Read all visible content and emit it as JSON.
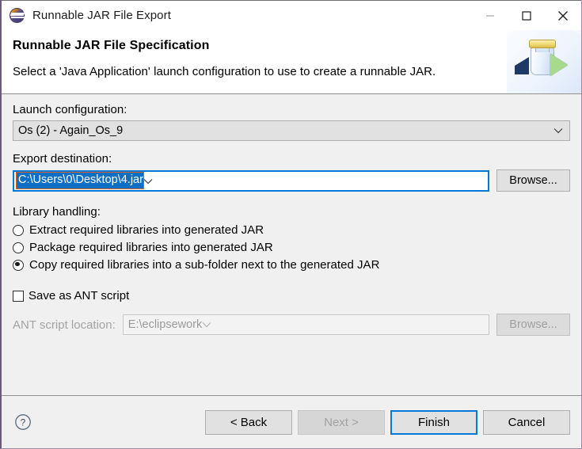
{
  "window": {
    "title": "Runnable JAR File Export",
    "app_icon": "eclipse-icon",
    "controls": {
      "minimize": "minimize-icon",
      "maximize": "maximize-icon",
      "close": "close-icon"
    }
  },
  "header": {
    "title": "Runnable JAR File Specification",
    "description": "Select a 'Java Application' launch configuration to use to create a runnable JAR.",
    "banner_icon": "runnable-jar-banner-icon"
  },
  "launch_configuration": {
    "label": "Launch configuration:",
    "value": "Os (2) - Again_Os_9",
    "dropdown_icon": "chevron-down-icon"
  },
  "export_destination": {
    "label": "Export destination:",
    "value": "C:\\Users\\0\\Desktop\\4.jar",
    "selected": true,
    "dropdown_icon": "chevron-down-icon",
    "browse_label": "Browse..."
  },
  "library_handling": {
    "label": "Library handling:",
    "options": [
      {
        "label": "Extract required libraries into generated JAR",
        "checked": false
      },
      {
        "label": "Package required libraries into generated JAR",
        "checked": false
      },
      {
        "label": "Copy required libraries into a sub-folder next to the generated JAR",
        "checked": true
      }
    ]
  },
  "ant_script": {
    "checkbox_label": "Save as ANT script",
    "checked": false,
    "location_label": "ANT script location:",
    "location_value": "E:\\eclipsework",
    "dropdown_icon": "chevron-down-icon",
    "browse_label": "Browse...",
    "enabled": false
  },
  "footer": {
    "help_icon": "help-question-icon",
    "buttons": [
      {
        "label": "< Back",
        "state": "enabled"
      },
      {
        "label": "Next >",
        "state": "disabled"
      },
      {
        "label": "Finish",
        "state": "default"
      },
      {
        "label": "Cancel",
        "state": "enabled"
      }
    ]
  },
  "colors": {
    "accent": "#0078d7",
    "selection": "#0e6fc4",
    "dialog_bg": "#f0f0f0",
    "control_bg": "#e1e1e1"
  }
}
